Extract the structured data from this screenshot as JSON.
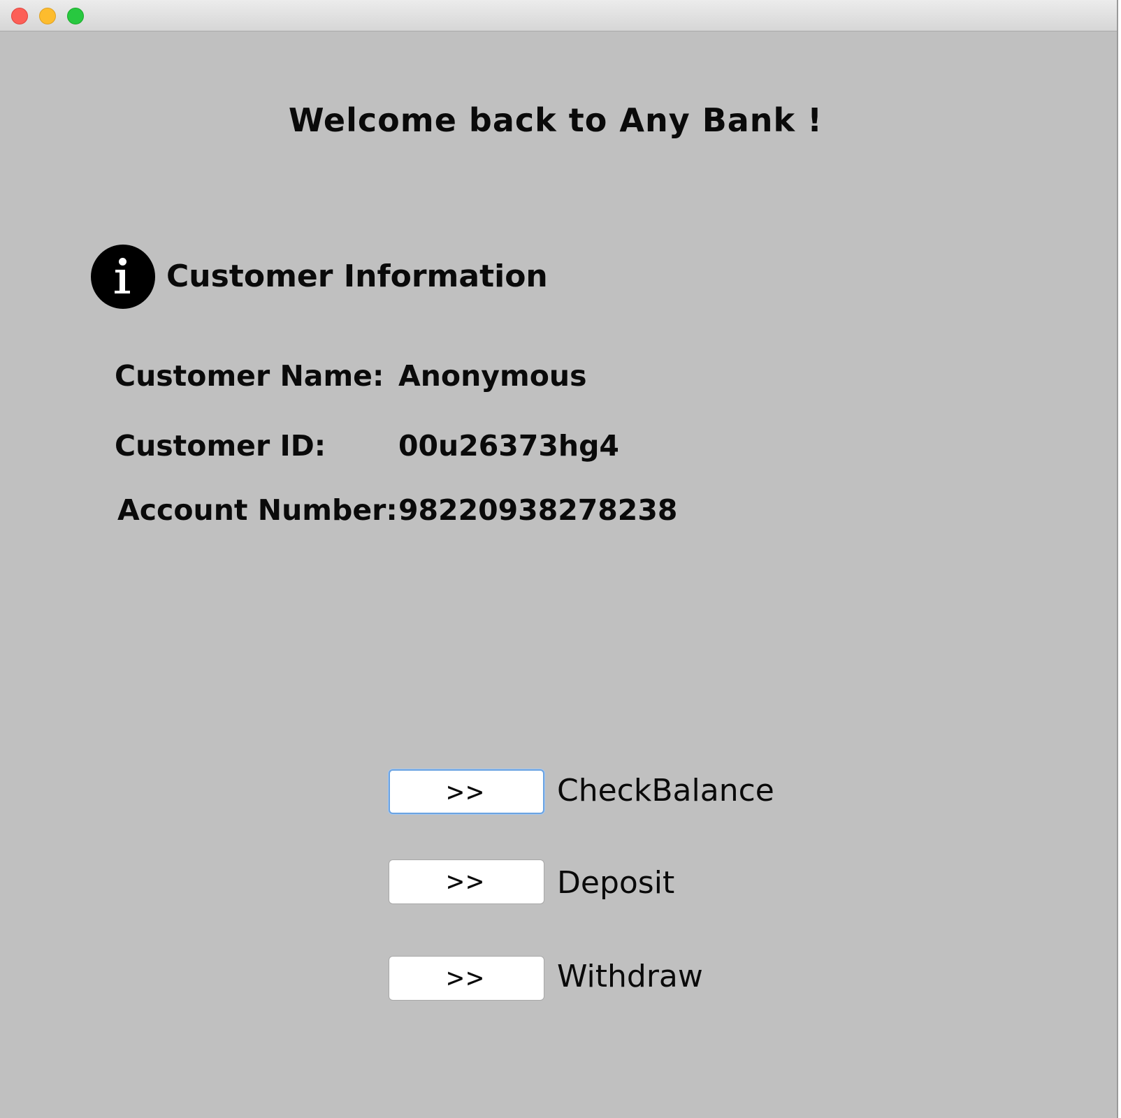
{
  "window": {
    "controls": [
      "close",
      "minimize",
      "zoom"
    ]
  },
  "header": {
    "welcome": "Welcome back to Any Bank !"
  },
  "customer_info": {
    "icon": "info-icon",
    "title": "Customer Information",
    "fields": [
      {
        "label": "Customer Name:",
        "value": "Anonymous"
      },
      {
        "label": "Customer ID:",
        "value": "00u26373hg4"
      },
      {
        "label": "Account Number:",
        "value": "98220938278238"
      }
    ]
  },
  "actions": [
    {
      "button_label": ">>",
      "label": "CheckBalance",
      "focused": true
    },
    {
      "button_label": ">>",
      "label": "Deposit",
      "focused": false
    },
    {
      "button_label": ">>",
      "label": "Withdraw",
      "focused": false
    }
  ],
  "colors": {
    "window_background": "#c0c0c0",
    "focus_ring": "#6ba3e2",
    "close": "#fc5f57",
    "minimize": "#fdbc2e",
    "zoom": "#28c840"
  }
}
